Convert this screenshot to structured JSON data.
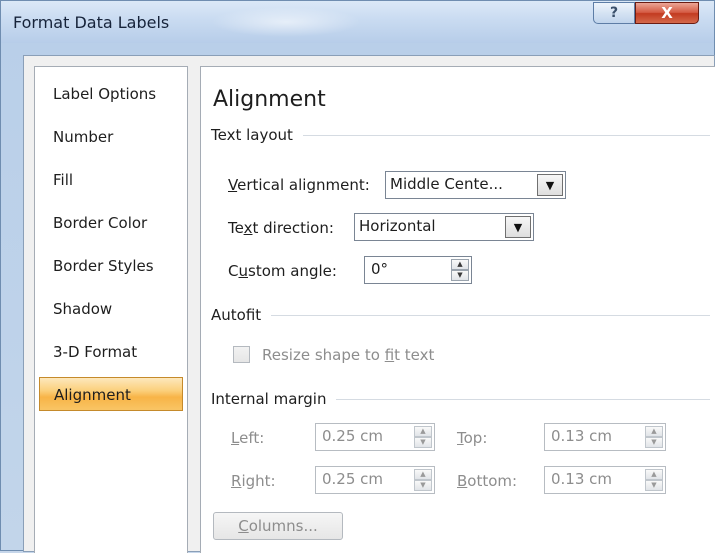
{
  "window": {
    "title": "Format Data Labels",
    "help_glyph": "?",
    "close_glyph": "X"
  },
  "nav": {
    "items": [
      {
        "label": "Label Options",
        "selected": false
      },
      {
        "label": "Number",
        "selected": false
      },
      {
        "label": "Fill",
        "selected": false
      },
      {
        "label": "Border Color",
        "selected": false
      },
      {
        "label": "Border Styles",
        "selected": false
      },
      {
        "label": "Shadow",
        "selected": false
      },
      {
        "label": "3-D Format",
        "selected": false
      },
      {
        "label": "Alignment",
        "selected": true
      }
    ]
  },
  "panel": {
    "heading": "Alignment",
    "text_layout": {
      "header": "Text layout",
      "vertical_alignment": {
        "label_accel": "V",
        "label_rest": "ertical alignment:",
        "value": "Middle Cente..."
      },
      "text_direction": {
        "label_pre": "Te",
        "label_accel": "x",
        "label_rest": "t direction:",
        "value": "Horizontal"
      },
      "custom_angle": {
        "label_pre": "C",
        "label_accel": "u",
        "label_rest": "stom angle:",
        "value": "0°"
      }
    },
    "autofit": {
      "header": "Autofit",
      "resize_label_pre": "Resize shape to ",
      "resize_label_accel": "f",
      "resize_label_rest": "it text",
      "checked": false
    },
    "internal_margin": {
      "header": "Internal margin",
      "left": {
        "label_accel": "L",
        "label_rest": "eft:",
        "value": "0.25 cm"
      },
      "right": {
        "label_accel": "R",
        "label_rest": "ight:",
        "value": "0.25 cm"
      },
      "top": {
        "label_accel": "T",
        "label_rest": "op:",
        "value": "0.13 cm"
      },
      "bottom": {
        "label_accel": "B",
        "label_rest": "ottom:",
        "value": "0.13 cm"
      },
      "columns_button": {
        "label_accel": "C",
        "label_rest": "olumns..."
      }
    }
  },
  "icons": {
    "dropdown_arrow": "▼",
    "spin_up": "▲",
    "spin_down": "▼"
  }
}
